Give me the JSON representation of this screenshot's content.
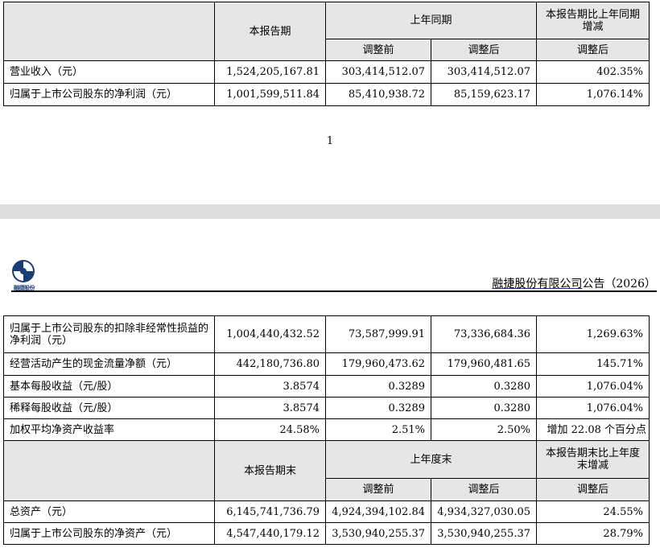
{
  "page_number": "1",
  "header": {
    "logo_text": "融捷股份",
    "company": "融捷股份有限公司",
    "notice": "公告（2026）"
  },
  "table1": {
    "col_current": "本报告期",
    "col_prior": "上年同期",
    "col_change": "本报告期比上年同期增减",
    "sub_before": "调整前",
    "sub_after": "调整后",
    "sub_change": "调整后",
    "rows": [
      {
        "label": "营业收入（元）",
        "current": "1,524,205,167.81",
        "before": "303,414,512.07",
        "after": "303,414,512.07",
        "change": "402.35%"
      },
      {
        "label": "归属于上市公司股东的净利润（元）",
        "current": "1,001,599,511.84",
        "before": "85,410,938.72",
        "after": "85,159,623.17",
        "change": "1,076.14%"
      }
    ]
  },
  "table2": {
    "rows": [
      {
        "label": "归属于上市公司股东的扣除非经常性损益的净利润（元）",
        "current": "1,004,440,432.52",
        "before": "73,587,999.91",
        "after": "73,336,684.36",
        "change": "1,269.63%"
      },
      {
        "label": "经营活动产生的现金流量净额（元）",
        "current": "442,180,736.80",
        "before": "179,960,473.62",
        "after": "179,960,481.65",
        "change": "145.71%"
      },
      {
        "label": "基本每股收益（元/股）",
        "current": "3.8574",
        "before": "0.3289",
        "after": "0.3280",
        "change": "1,076.04%"
      },
      {
        "label": "稀释每股收益（元/股）",
        "current": "3.8574",
        "before": "0.3289",
        "after": "0.3280",
        "change": "1,076.04%"
      },
      {
        "label": "加权平均净资产收益率",
        "current": "24.58%",
        "before": "2.51%",
        "after": "2.50%",
        "change": "增加 22.08 个百分点"
      }
    ],
    "col_current": "本报告期末",
    "col_prior": "上年度末",
    "col_change": "本报告期末比上年度末增减",
    "sub_before": "调整前",
    "sub_after": "调整后",
    "sub_change": "调整后",
    "rows2": [
      {
        "label": "总资产（元）",
        "current": "6,145,741,736.79",
        "before": "4,924,394,102.84",
        "after": "4,934,327,030.05",
        "change": "24.55%"
      },
      {
        "label": "归属于上市公司股东的净资产（元）",
        "current": "4,547,440,179.12",
        "before": "3,530,940,255.37",
        "after": "3,530,940,255.37",
        "change": "28.79%"
      }
    ]
  },
  "colors": {
    "table_header_bg": "#e6e6e6",
    "gap_bg": "#dcdcdc",
    "logo_blue": "#1a3d78"
  }
}
